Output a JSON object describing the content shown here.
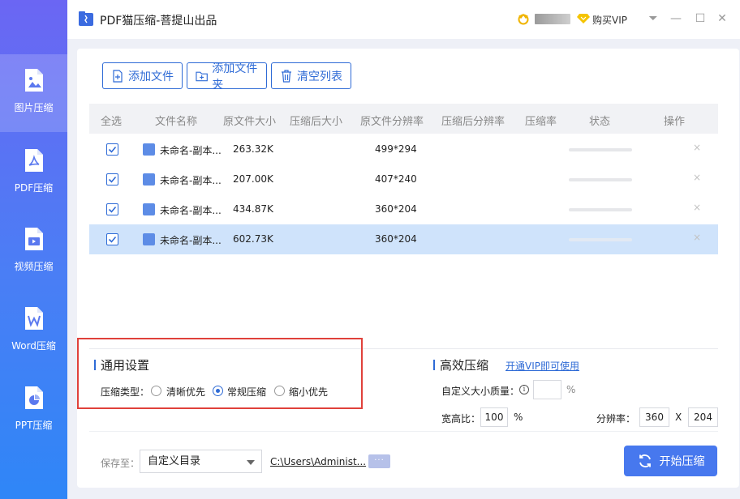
{
  "app": {
    "title": "PDF猫压缩-菩提山出品",
    "vip_label": "购买VIP"
  },
  "window_controls": {
    "menu": "⏷",
    "minimize": "—",
    "maximize": "☐",
    "close": "✕"
  },
  "sidebar": {
    "items": [
      {
        "label": "图片压缩",
        "icon": "image-file-icon",
        "active": true
      },
      {
        "label": "PDF压缩",
        "icon": "pdf-file-icon",
        "active": false
      },
      {
        "label": "视频压缩",
        "icon": "video-file-icon",
        "active": false
      },
      {
        "label": "Word压缩",
        "icon": "word-file-icon",
        "active": false
      },
      {
        "label": "PPT压缩",
        "icon": "ppt-file-icon",
        "active": false
      }
    ]
  },
  "toolbar": {
    "add_file": "添加文件",
    "add_folder": "添加文件夹",
    "clear_list": "清空列表"
  },
  "table": {
    "headers": [
      "全选",
      "文件名称",
      "原文件大小",
      "压缩后大小",
      "原文件分辨率",
      "压缩后分辨率",
      "压缩率",
      "状态",
      "操作"
    ],
    "rows": [
      {
        "name": "未命名-副本...",
        "size": "263.32K",
        "resolution": "499*294",
        "checked": true,
        "selected": false
      },
      {
        "name": "未命名-副本...",
        "size": "207.00K",
        "resolution": "407*240",
        "checked": true,
        "selected": false
      },
      {
        "name": "未命名-副本...",
        "size": "434.87K",
        "resolution": "360*204",
        "checked": true,
        "selected": false
      },
      {
        "name": "未命名-副本...",
        "size": "602.73K",
        "resolution": "360*204",
        "checked": true,
        "selected": true
      }
    ],
    "remove_label": "×"
  },
  "general_settings": {
    "title": "通用设置",
    "compress_type_label": "压缩类型：",
    "options": [
      "清晰优先",
      "常规压缩",
      "缩小优先"
    ],
    "selected_index": 1
  },
  "efficient": {
    "title": "高效压缩",
    "vip_link": "开通VIP即可使用",
    "quality_label": "自定义大小质量：",
    "quality_value": "",
    "quality_unit": "%",
    "ratio_label": "宽高比：",
    "ratio_value": "100",
    "ratio_unit": "%",
    "resolution_label": "分辨率：",
    "width": "360",
    "sep": "X",
    "height": "204"
  },
  "footer": {
    "save_label": "保存至：",
    "save_option": "自定义目录",
    "path": "C:\\Users\\Administ...",
    "more": "···",
    "start_label": "开始压缩"
  },
  "colors": {
    "accent": "#2f6bd6",
    "start_button": "#4778ee",
    "highlight": "#e0413b",
    "selected_row": "#cfe3fb"
  }
}
